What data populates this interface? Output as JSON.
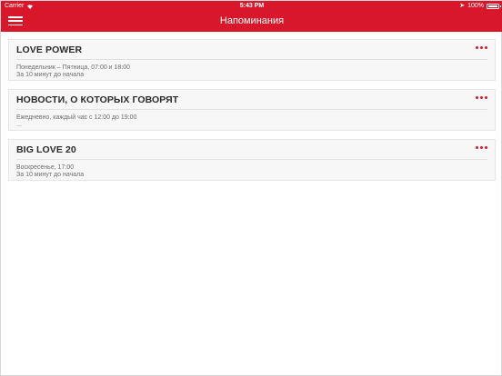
{
  "status_bar": {
    "carrier": "Carrier",
    "time": "5:43 PM",
    "battery": "100%"
  },
  "header": {
    "title": "Напоминания"
  },
  "colors": {
    "accent": "#d9172a",
    "card_bg": "#f7f7f7"
  },
  "reminders": [
    {
      "title": "LOVE POWER",
      "schedule": "Понедельник – Пятница, 07:00 и 18:00",
      "note": "За 10 минут до начала"
    },
    {
      "title": "НОВОСТИ, О КОТОРЫХ ГОВОРЯТ",
      "schedule": "Ежедневно, каждый час с 12:00 до 19:00",
      "note": "..."
    },
    {
      "title": "BIG LOVE 20",
      "schedule": "Воскресенье, 17:00",
      "note": "За 10 минут до начала"
    }
  ]
}
